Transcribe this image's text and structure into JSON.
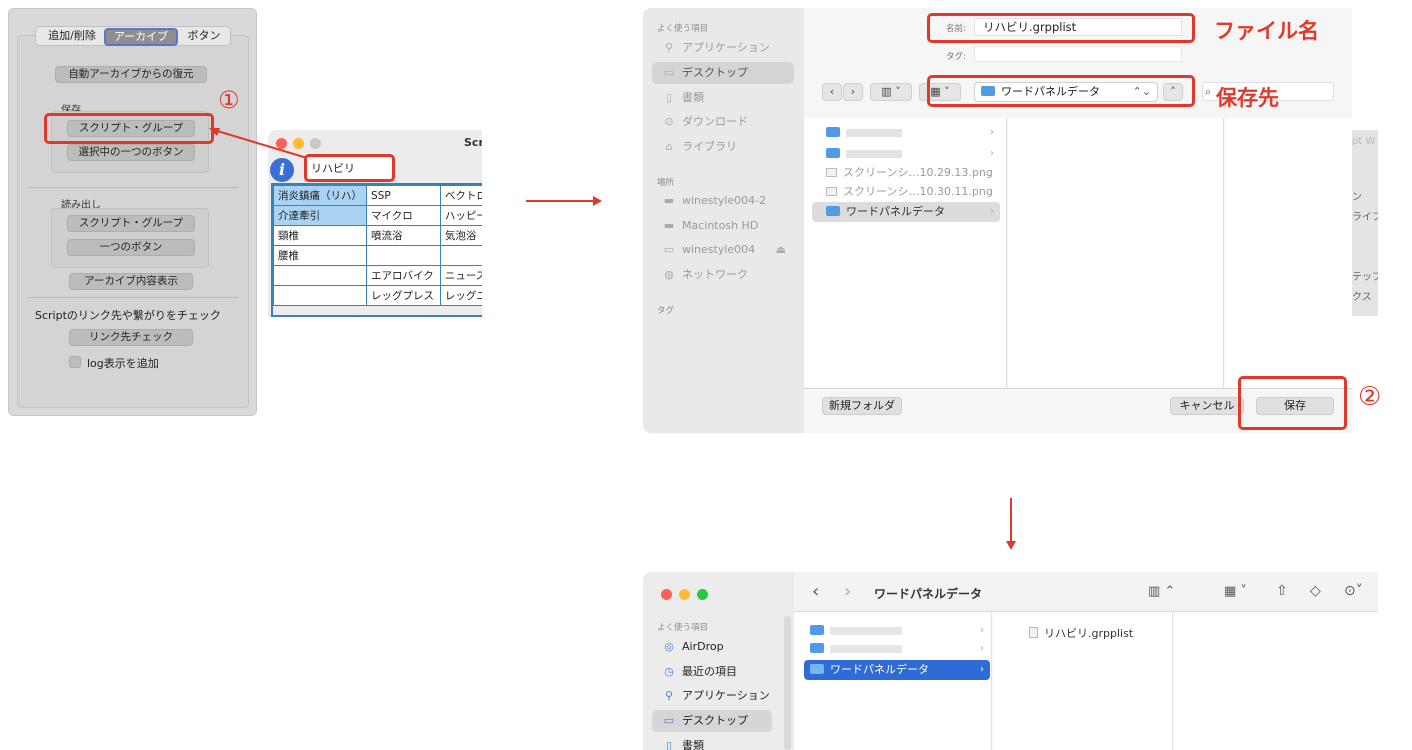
{
  "panel1": {
    "tabs": [
      "追加/削除",
      "アーカイブ",
      "ボタン"
    ],
    "restore_button": "自動アーカイブからの復元",
    "save_label": "保存",
    "save_script_group": "スクリプト・グループ",
    "save_selected_button": "選択中の一つのボタン",
    "load_label": "読み出し",
    "load_script_group": "スクリプト・グループ",
    "load_one_button": "一つのボタン",
    "archive_view": "アーカイブ内容表示",
    "link_check_label": "Scriptのリンク先や繋がりをチェック",
    "link_check_button": "リンク先チェック",
    "log_checkbox": "log表示を追加",
    "step1": "①"
  },
  "panel2": {
    "title": "Scri",
    "name_value": "リハビリ",
    "rows": [
      [
        "消炎鎮痛（リハ）",
        "SSP",
        "ベクトロ"
      ],
      [
        "介達牽引",
        "マイクロ",
        "ハッピー"
      ],
      [
        "頸椎",
        "噴流浴",
        "気泡浴"
      ],
      [
        "腰椎",
        "",
        ""
      ],
      [
        "",
        "エアロバイク",
        "ニュース"
      ],
      [
        "",
        "レッグプレス",
        "レッグユ"
      ]
    ]
  },
  "panel3": {
    "sidebar": {
      "favorites_header": "よく使う項目",
      "favorites": [
        "アプリケーション",
        "デスクトップ",
        "書類",
        "ダウンロード",
        "ライブラリ"
      ],
      "locations_header": "場所",
      "locations": [
        "winestyle004-2",
        "Macintosh HD",
        "winestyle004",
        "ネットワーク"
      ],
      "tags_header": "タグ"
    },
    "name_label": "名前:",
    "name_value": "リハビリ.grpplist",
    "tags_label": "タグ:",
    "location_value": "ワードパネルデータ",
    "files": [
      {
        "name": "",
        "kind": "folder"
      },
      {
        "name": "",
        "kind": "folder"
      },
      {
        "name": "スクリーンシ…10.29.13.png",
        "kind": "png"
      },
      {
        "name": "スクリーンシ…10.30.11.png",
        "kind": "png"
      },
      {
        "name": "ワードパネルデータ",
        "kind": "folder"
      }
    ],
    "new_folder": "新規フォルダ",
    "cancel": "キャンセル",
    "save": "保存",
    "ann_filename": "ファイル名",
    "ann_location": "保存先",
    "step2": "②",
    "peek_lines": [
      "pt W",
      "ン",
      "ライフ",
      "テップ",
      "クス"
    ]
  },
  "panel4": {
    "title": "ワードパネルデータ",
    "sidebar_header": "よく使う項目",
    "sidebar_items": [
      "AirDrop",
      "最近の項目",
      "アプリケーション",
      "デスクトップ",
      "書類"
    ],
    "col1": [
      "",
      "",
      "ワードパネルデータ"
    ],
    "file": "リハビリ.grpplist"
  },
  "colors": {
    "accent_red": "#e0392b",
    "finder_select": "#2e6bd6",
    "folder_blue": "#4f9be6"
  }
}
